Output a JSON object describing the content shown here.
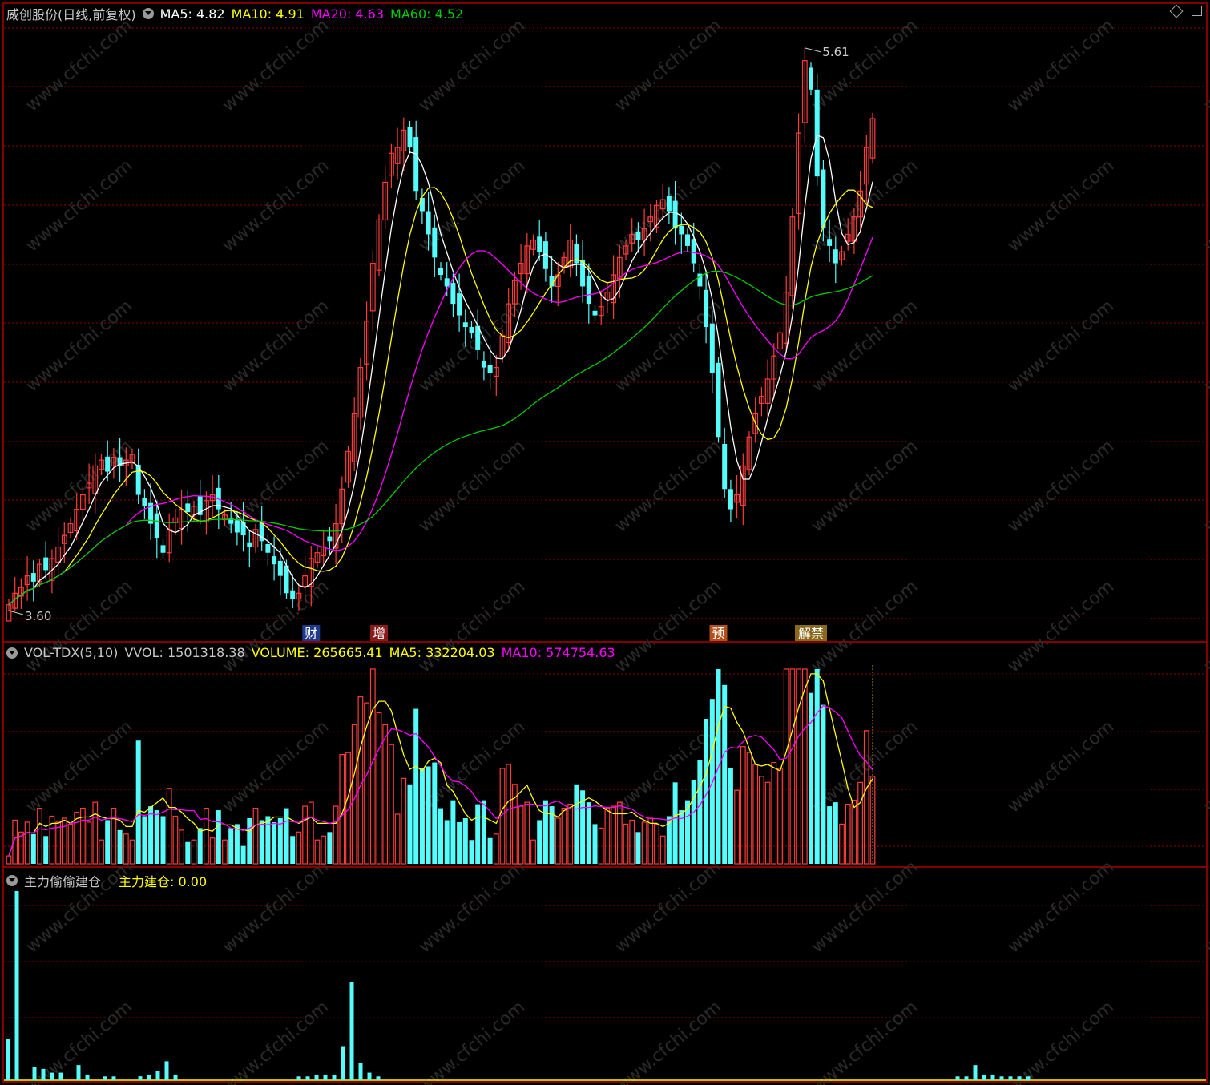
{
  "header": {
    "stock_title": "威创股份(日线,前复权)",
    "ma5": "MA5: 4.82",
    "ma10": "MA10: 4.91",
    "ma20": "MA20: 4.63",
    "ma60": "MA60: 4.52",
    "high_label": "5.61",
    "low_label": "3.60"
  },
  "event_markers": [
    {
      "text": "财",
      "bar": 49,
      "color": "#1e3a8a"
    },
    {
      "text": "增",
      "bar": 60,
      "color": "#8b1a1a"
    },
    {
      "text": "预",
      "bar": 115,
      "color": "#b3501a"
    },
    {
      "text": "解禁",
      "bar": 130,
      "color": "#8a6a1a"
    }
  ],
  "vol_header": {
    "name": "VOL-TDX(5,10)",
    "vvol": "VVOL: 1501318.38",
    "volume": "VOLUME: 265665.41",
    "ma5": "MA5: 332204.03",
    "ma10": "MA10: 574754.63"
  },
  "ind_header": {
    "name": "主力偷偷建仓",
    "value": "主力建仓: 0.00"
  },
  "watermark": "www.cfchi.com",
  "colors": {
    "up": "#ff3c3c",
    "down": "#54fcfc",
    "ma5": "#ffffff",
    "ma10": "#ffff00",
    "ma20": "#ff00ff",
    "ma60": "#00cc00",
    "grid": "#8b0000",
    "frame": "#b00000"
  },
  "chart_data": {
    "type": "candlestick",
    "price_range": [
      3.6,
      5.61
    ],
    "close": [
      3.62,
      3.66,
      3.68,
      3.72,
      3.7,
      3.76,
      3.74,
      3.78,
      3.82,
      3.86,
      3.9,
      3.95,
      4.0,
      4.04,
      4.1,
      4.12,
      4.08,
      4.13,
      4.1,
      4.12,
      4.14,
      4.0,
      3.96,
      3.9,
      3.85,
      3.8,
      3.88,
      3.92,
      3.95,
      3.94,
      3.96,
      3.93,
      3.98,
      4.0,
      3.95,
      3.93,
      3.9,
      3.87,
      3.86,
      3.82,
      3.88,
      3.84,
      3.8,
      3.76,
      3.72,
      3.66,
      3.64,
      3.66,
      3.72,
      3.78,
      3.8,
      3.82,
      3.84,
      3.9,
      4.02,
      4.15,
      4.28,
      4.44,
      4.6,
      4.8,
      4.95,
      5.08,
      5.18,
      5.2,
      5.26,
      5.2,
      5.05,
      4.98,
      4.9,
      4.82,
      4.76,
      4.72,
      4.66,
      4.62,
      4.58,
      4.56,
      4.5,
      4.44,
      4.42,
      4.44,
      4.55,
      4.66,
      4.74,
      4.8,
      4.86,
      4.88,
      4.84,
      4.78,
      4.72,
      4.76,
      4.82,
      4.88,
      4.8,
      4.72,
      4.66,
      4.62,
      4.65,
      4.7,
      4.76,
      4.82,
      4.86,
      4.9,
      4.88,
      4.92,
      4.96,
      5.0,
      5.02,
      4.98,
      4.92,
      4.9,
      4.86,
      4.8,
      4.72,
      4.58,
      4.42,
      4.2,
      4.02,
      3.95,
      4.0,
      4.1,
      4.2,
      4.28,
      4.34,
      4.4,
      4.48,
      4.56,
      4.7,
      4.96,
      5.25,
      5.5,
      5.4,
      5.1,
      4.92,
      4.86,
      4.8,
      4.84,
      4.9,
      4.96,
      5.05,
      5.2,
      5.3
    ],
    "volume_scale": [
      0,
      1501318.38
    ],
    "vol_ma5": "MA5: 332204.03",
    "vol_ma10": "MA10: 574754.63",
    "indicator_name": "主力建仓",
    "indicator_value": 0.0
  }
}
